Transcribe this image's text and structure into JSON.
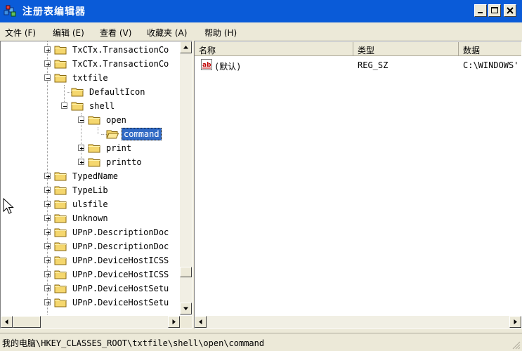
{
  "window": {
    "title": "注册表编辑器"
  },
  "menu": [
    "文件 (F)",
    "编辑 (E)",
    "查看 (V)",
    "收藏夹 (A)",
    "帮助 (H)"
  ],
  "tree": {
    "nodes": [
      {
        "label": "TxCTx.TransactionCo",
        "state": "collapsed"
      },
      {
        "label": "TxCTx.TransactionCo",
        "state": "collapsed"
      },
      {
        "label": "txtfile",
        "state": "expanded"
      },
      {
        "label": "DefaultIcon",
        "state": "leaf"
      },
      {
        "label": "shell",
        "state": "expanded"
      },
      {
        "label": "open",
        "state": "expanded"
      },
      {
        "label": "command",
        "state": "selected"
      },
      {
        "label": "print",
        "state": "collapsed"
      },
      {
        "label": "printto",
        "state": "collapsed"
      },
      {
        "label": "TypedName",
        "state": "collapsed"
      },
      {
        "label": "TypeLib",
        "state": "collapsed"
      },
      {
        "label": "ulsfile",
        "state": "collapsed"
      },
      {
        "label": "Unknown",
        "state": "collapsed"
      },
      {
        "label": "UPnP.DescriptionDoc",
        "state": "collapsed"
      },
      {
        "label": "UPnP.DescriptionDoc",
        "state": "collapsed"
      },
      {
        "label": "UPnP.DeviceHostICSS",
        "state": "collapsed"
      },
      {
        "label": "UPnP.DeviceHostICSS",
        "state": "collapsed"
      },
      {
        "label": "UPnP.DeviceHostSetu",
        "state": "collapsed"
      },
      {
        "label": "UPnP.DeviceHostSetu",
        "state": "collapsed"
      }
    ]
  },
  "list": {
    "columns": [
      "名称",
      "类型",
      "数据"
    ],
    "rows": [
      {
        "name": "(默认)",
        "type": "REG_SZ",
        "data": "C:\\WINDOWS'",
        "icon": "string-value-icon"
      }
    ]
  },
  "status": {
    "path": "我的电脑\\HKEY_CLASSES_ROOT\\txtfile\\shell\\open\\command"
  },
  "colors": {
    "title_bar": "#0a5bd8",
    "selection": "#316ac5",
    "chrome": "#ece9d8"
  }
}
